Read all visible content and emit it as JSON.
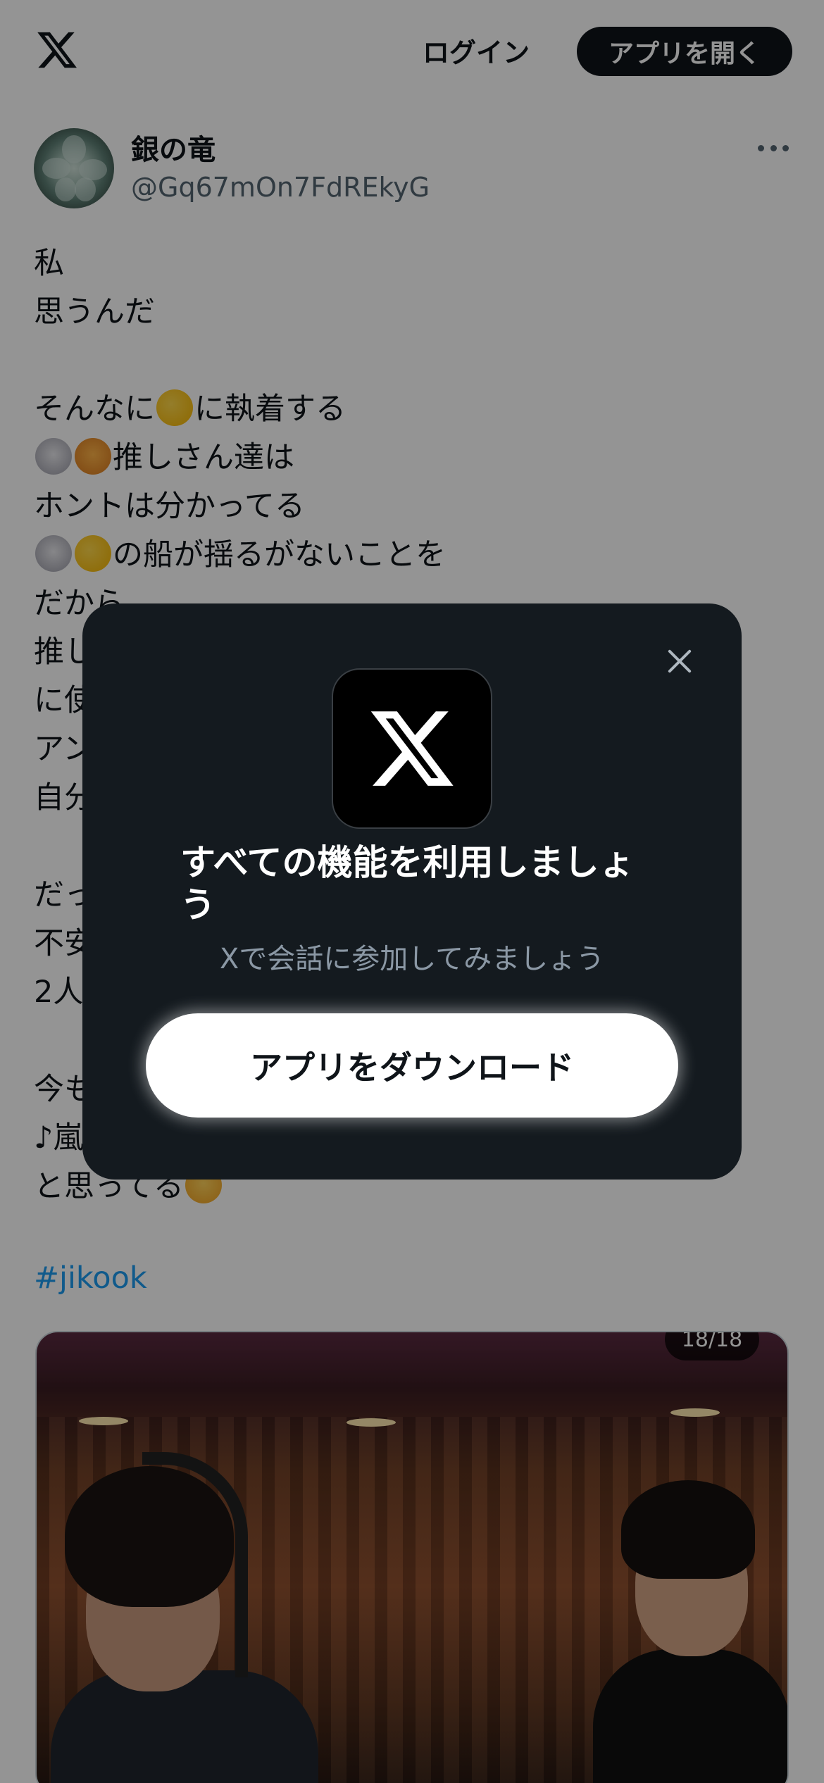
{
  "header": {
    "logo_icon": "x-logo-icon",
    "login_label": "ログイン",
    "open_app_label": "アプリを開く"
  },
  "post": {
    "display_name": "銀の竜",
    "handle": "@Gq67mOn7FdREkyG",
    "more_icon": "more-dots-icon",
    "lines": [
      {
        "text": "私"
      },
      {
        "text": "思うんだ"
      },
      {
        "text": ""
      },
      {
        "pre": "そんなに",
        "emoji": [
          "chick"
        ],
        "post": "に執着する"
      },
      {
        "pre": "",
        "emoji": [
          "rabbit",
          "tiger"
        ],
        "post": "推しさん達は"
      },
      {
        "text": "ホントは分かってる"
      },
      {
        "pre": "",
        "emoji": [
          "rabbit",
          "chick"
        ],
        "post": "の船が揺るがないことを"
      },
      {
        "text": "だから"
      },
      {
        "text": "推し"
      },
      {
        "text": "に使"
      },
      {
        "text": "アン"
      },
      {
        "text": "自分"
      },
      {
        "text": ""
      },
      {
        "text": "だっ"
      },
      {
        "text": "不安"
      },
      {
        "text": "2人"
      },
      {
        "text": ""
      },
      {
        "text": "今も"
      },
      {
        "text": "♪嵐"
      },
      {
        "pre": "と思ってる",
        "emoji": [
          "smile"
        ],
        "post": ""
      }
    ],
    "hashtag": "#jikook",
    "media": {
      "counter": "18/18"
    }
  },
  "modal": {
    "close_icon": "close-icon",
    "app_icon": "x-app-icon",
    "title": "すべての機能を利用しましょう",
    "subtitle": "Xで会話に参加してみましょう",
    "download_label": "アプリをダウンロード"
  },
  "colors": {
    "text_primary": "#0f1419",
    "text_secondary": "#536471",
    "link": "#1d9bf0",
    "modal_bg": "#141a1f",
    "overlay": "rgba(0,0,0,0.42)"
  }
}
